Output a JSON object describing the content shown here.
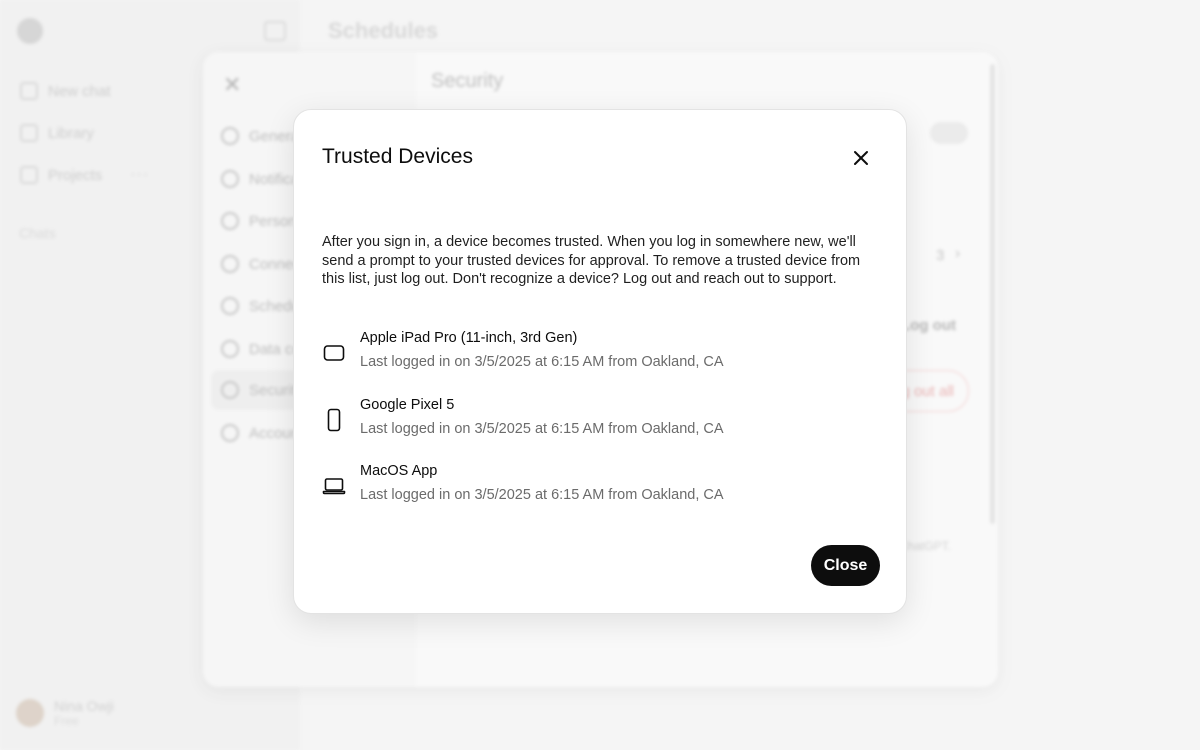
{
  "background": {
    "sidebar": {
      "items": [
        {
          "label": "New chat",
          "icon": "compose-icon"
        },
        {
          "label": "Library",
          "icon": "library-icon"
        },
        {
          "label": "Projects",
          "icon": "folder-icon"
        }
      ],
      "more": "···",
      "chats_label": "Chats",
      "user": {
        "name": "Nina Owji",
        "plan": "Free"
      }
    },
    "page_title": "Schedules",
    "settings": {
      "title": "Security",
      "nav": [
        {
          "label": "General",
          "icon": "gear-icon"
        },
        {
          "label": "Notifications",
          "icon": "bell-icon"
        },
        {
          "label": "Personalization",
          "icon": "personalization-icon"
        },
        {
          "label": "Connectors",
          "icon": "connectors-icon"
        },
        {
          "label": "Schedules",
          "icon": "clock-icon"
        },
        {
          "label": "Data controls",
          "icon": "database-icon"
        },
        {
          "label": "Security",
          "icon": "shield-icon"
        },
        {
          "label": "Account",
          "icon": "account-icon"
        }
      ],
      "trusted_count": "3",
      "log_out": "Log out",
      "log_out_all": "Log out all",
      "note": "ChatGPT."
    }
  },
  "modal": {
    "title": "Trusted Devices",
    "description": "After you sign in, a device becomes trusted. When you log in somewhere new, we'll send a prompt to your trusted devices for approval. To remove a trusted device from this list, just log out. Don't recognize a device? Log out and reach out to support.",
    "devices": [
      {
        "name": "Apple iPad Pro (11-inch, 3rd Gen)",
        "meta": "Last logged in on 3/5/2025 at 6:15 AM from Oakland, CA",
        "icon": "tablet-icon"
      },
      {
        "name": "Google Pixel 5",
        "meta": "Last logged in on 3/5/2025 at 6:15 AM from Oakland, CA",
        "icon": "phone-icon"
      },
      {
        "name": "MacOS App",
        "meta": "Last logged in on 3/5/2025 at 6:15 AM from Oakland, CA",
        "icon": "laptop-icon"
      }
    ],
    "close_label": "Close"
  },
  "colors": {
    "primary_button": "#0d0d0d",
    "danger": "#e29a9a"
  }
}
